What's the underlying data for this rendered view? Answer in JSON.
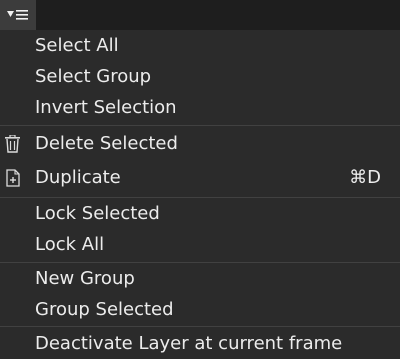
{
  "trigger": {
    "icon": "menu-list-icon"
  },
  "menu": {
    "group1": [
      "Select All",
      "Select Group",
      "Invert Selection"
    ],
    "group2": {
      "delete": {
        "label": "Delete Selected",
        "icon": "trash-icon"
      },
      "duplicate": {
        "label": "Duplicate",
        "icon": "duplicate-icon",
        "shortcut": "⌘D"
      }
    },
    "group3": [
      "Lock Selected",
      "Lock All"
    ],
    "group4": [
      "New Group",
      "Group Selected"
    ],
    "group5": [
      "Deactivate Layer at current frame"
    ]
  }
}
